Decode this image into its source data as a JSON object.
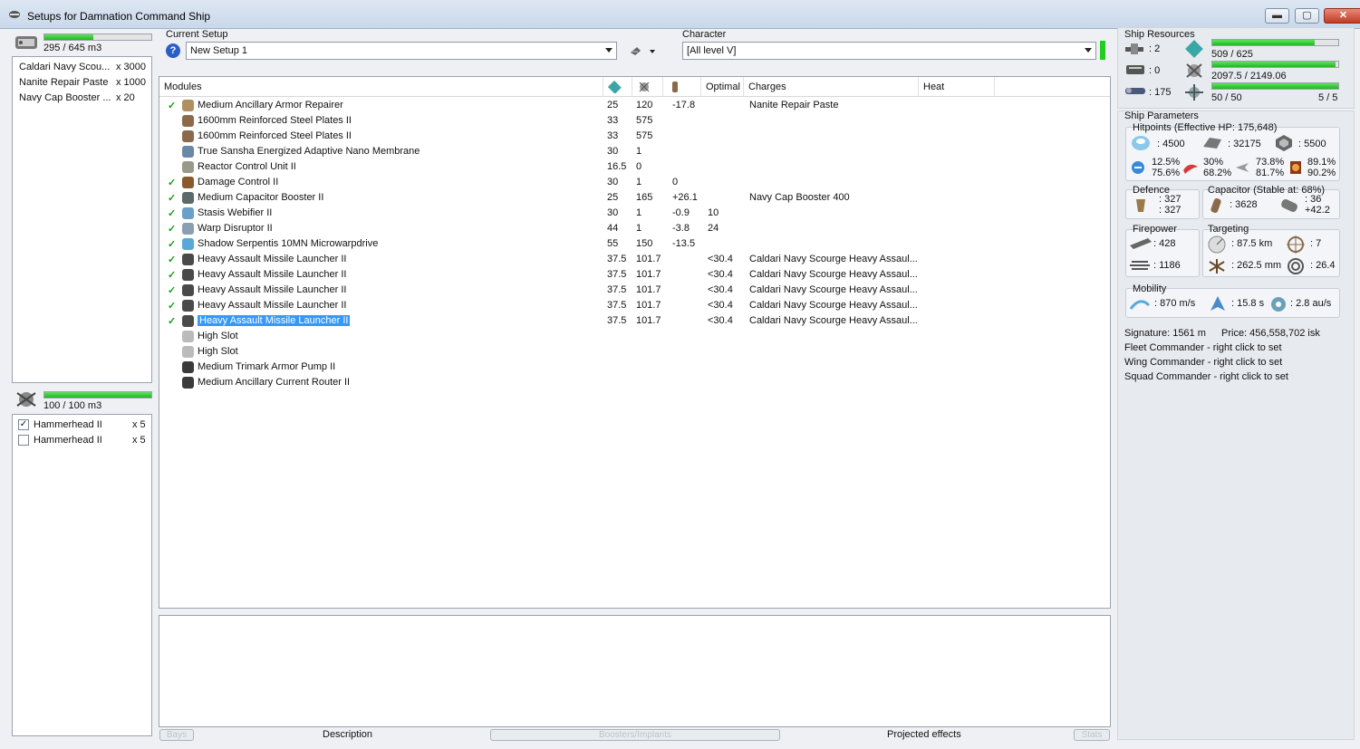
{
  "window": {
    "title": "Setups for Damnation Command Ship",
    "minimize": "▬",
    "maximize": "▢",
    "close": "✕"
  },
  "cargo": {
    "volume": "295 / 645 m3",
    "fill": 0.46,
    "items": [
      {
        "name": "Caldari Navy Scou...",
        "qty": "x 3000"
      },
      {
        "name": "Nanite Repair Paste",
        "qty": "x 1000"
      },
      {
        "name": "Navy Cap Booster ...",
        "qty": "x 20"
      }
    ]
  },
  "drones": {
    "volume": "100 / 100 m3",
    "fill": 1.0,
    "items": [
      {
        "name": "Hammerhead II",
        "qty": "x 5",
        "checked": true
      },
      {
        "name": "Hammerhead II",
        "qty": "x 5",
        "checked": false
      }
    ]
  },
  "setup": {
    "label": "Current Setup",
    "value": "New Setup 1",
    "help": "?"
  },
  "character": {
    "label": "Character",
    "value": "[All level V]"
  },
  "columns": {
    "modules": "Modules",
    "optimal": "Optimal",
    "charges": "Charges",
    "heat": "Heat"
  },
  "modules": [
    {
      "name": "Medium Ancillary Armor Repairer",
      "cpu": "25",
      "pg": "120",
      "cap": "-17.8",
      "optimal": "",
      "charge": "Nanite Repair Paste",
      "active": true,
      "color": "#b09060"
    },
    {
      "name": "1600mm Reinforced Steel Plates II",
      "cpu": "33",
      "pg": "575",
      "cap": "",
      "optimal": "",
      "charge": "",
      "active": false,
      "color": "#8a6a4a"
    },
    {
      "name": "1600mm Reinforced Steel Plates II",
      "cpu": "33",
      "pg": "575",
      "cap": "",
      "optimal": "",
      "charge": "",
      "active": false,
      "color": "#8a6a4a"
    },
    {
      "name": "True Sansha Energized Adaptive Nano Membrane",
      "cpu": "30",
      "pg": "1",
      "cap": "",
      "optimal": "",
      "charge": "",
      "active": false,
      "color": "#6a88a8"
    },
    {
      "name": "Reactor Control Unit II",
      "cpu": "16.5",
      "pg": "0",
      "cap": "",
      "optimal": "",
      "charge": "",
      "active": false,
      "color": "#9a9a8a"
    },
    {
      "name": "Damage Control II",
      "cpu": "30",
      "pg": "1",
      "cap": "0",
      "optimal": "",
      "charge": "",
      "active": true,
      "color": "#8a5a2a"
    },
    {
      "name": "Medium Capacitor Booster II",
      "cpu": "25",
      "pg": "165",
      "cap": "+26.1",
      "optimal": "",
      "charge": "Navy Cap Booster 400",
      "active": true,
      "color": "#5a6a6a"
    },
    {
      "name": "Stasis Webifier II",
      "cpu": "30",
      "pg": "1",
      "cap": "-0.9",
      "optimal": "10",
      "charge": "",
      "active": true,
      "color": "#6aa0c8"
    },
    {
      "name": "Warp Disruptor II",
      "cpu": "44",
      "pg": "1",
      "cap": "-3.8",
      "optimal": "24",
      "charge": "",
      "active": true,
      "color": "#8aa0b0"
    },
    {
      "name": "Shadow Serpentis 10MN Microwarpdrive",
      "cpu": "55",
      "pg": "150",
      "cap": "-13.5",
      "optimal": "",
      "charge": "",
      "active": true,
      "color": "#58a8d8"
    },
    {
      "name": "Heavy Assault Missile Launcher II",
      "cpu": "37.5",
      "pg": "101.7",
      "cap": "",
      "optimal": "<30.4",
      "charge": "Caldari Navy Scourge Heavy Assaul...",
      "active": true,
      "color": "#4a4a4a"
    },
    {
      "name": "Heavy Assault Missile Launcher II",
      "cpu": "37.5",
      "pg": "101.7",
      "cap": "",
      "optimal": "<30.4",
      "charge": "Caldari Navy Scourge Heavy Assaul...",
      "active": true,
      "color": "#4a4a4a"
    },
    {
      "name": "Heavy Assault Missile Launcher II",
      "cpu": "37.5",
      "pg": "101.7",
      "cap": "",
      "optimal": "<30.4",
      "charge": "Caldari Navy Scourge Heavy Assaul...",
      "active": true,
      "color": "#4a4a4a"
    },
    {
      "name": "Heavy Assault Missile Launcher II",
      "cpu": "37.5",
      "pg": "101.7",
      "cap": "",
      "optimal": "<30.4",
      "charge": "Caldari Navy Scourge Heavy Assaul...",
      "active": true,
      "color": "#4a4a4a"
    },
    {
      "name": "Heavy Assault Missile Launcher II",
      "cpu": "37.5",
      "pg": "101.7",
      "cap": "",
      "optimal": "<30.4",
      "charge": "Caldari Navy Scourge Heavy Assaul...",
      "active": true,
      "color": "#4a4a4a",
      "selected": true
    },
    {
      "name": "High Slot",
      "cpu": "",
      "pg": "",
      "cap": "",
      "optimal": "",
      "charge": "",
      "active": false,
      "color": "#bbbbbb"
    },
    {
      "name": "High Slot",
      "cpu": "",
      "pg": "",
      "cap": "",
      "optimal": "",
      "charge": "",
      "active": false,
      "color": "#bbbbbb"
    },
    {
      "name": "Medium Trimark Armor Pump II",
      "cpu": "",
      "pg": "",
      "cap": "",
      "optimal": "",
      "charge": "",
      "active": false,
      "color": "#3a3a3a"
    },
    {
      "name": "Medium Ancillary Current Router II",
      "cpu": "",
      "pg": "",
      "cap": "",
      "optimal": "",
      "charge": "",
      "active": false,
      "color": "#3a3a3a"
    }
  ],
  "tabs": {
    "bays": "Bays",
    "description": "Description",
    "boosters": "Boosters/Implants",
    "projected": "Projected effects",
    "stats": "Stats"
  },
  "resources": {
    "title": "Ship Resources",
    "turrets": ": 2",
    "launchers": ": 0",
    "calibration": ": 175",
    "cpu": "509 / 625",
    "cpu_fill": 0.81,
    "pg": "2097.5 / 2149.06",
    "pg_fill": 0.98,
    "drone_bw": "50 / 50",
    "drone_bw_fill": 1.0,
    "drones_active": "5 / 5"
  },
  "params": {
    "title": "Ship Parameters",
    "hitpoints": {
      "title": "Hitpoints (Effective HP: 175,648)",
      "shield": ": 4500",
      "armor": ": 32175",
      "structure": ": 5500",
      "em_a": "12.5%",
      "em_b": "75.6%",
      "th_a": "30%",
      "th_b": "68.2%",
      "ki_a": "73.8%",
      "ki_b": "81.7%",
      "ex_a": "89.1%",
      "ex_b": "90.2%"
    },
    "defence": {
      "title": "Defence",
      "a": ": 327",
      "b": ": 327"
    },
    "capacitor": {
      "title": "Capacitor (Stable at: 68%)",
      "cap": ": 3628",
      "rate_a": ": 36",
      "rate_b": "+42.2"
    },
    "firepower": {
      "title": "Firepower",
      "dps": ": 428",
      "volley": ": 1186"
    },
    "targeting": {
      "title": "Targeting",
      "range": ": 87.5 km",
      "targets": ": 7",
      "scan": ": 262.5 mm",
      "sensor": ": 26.4"
    },
    "mobility": {
      "title": "Mobility",
      "speed": ": 870 m/s",
      "align": ": 15.8 s",
      "warp": ": 2.8 au/s"
    },
    "signature": "Signature: 1561 m",
    "price": "Price: 456,558,702 isk",
    "fleet": "Fleet Commander - right click to set",
    "wing": "Wing Commander - right click to set",
    "squad": "Squad Commander - right click to set"
  },
  "colors": {
    "accent": "#3399ff",
    "bar": "#22b522",
    "check": "#1a9c1a"
  }
}
